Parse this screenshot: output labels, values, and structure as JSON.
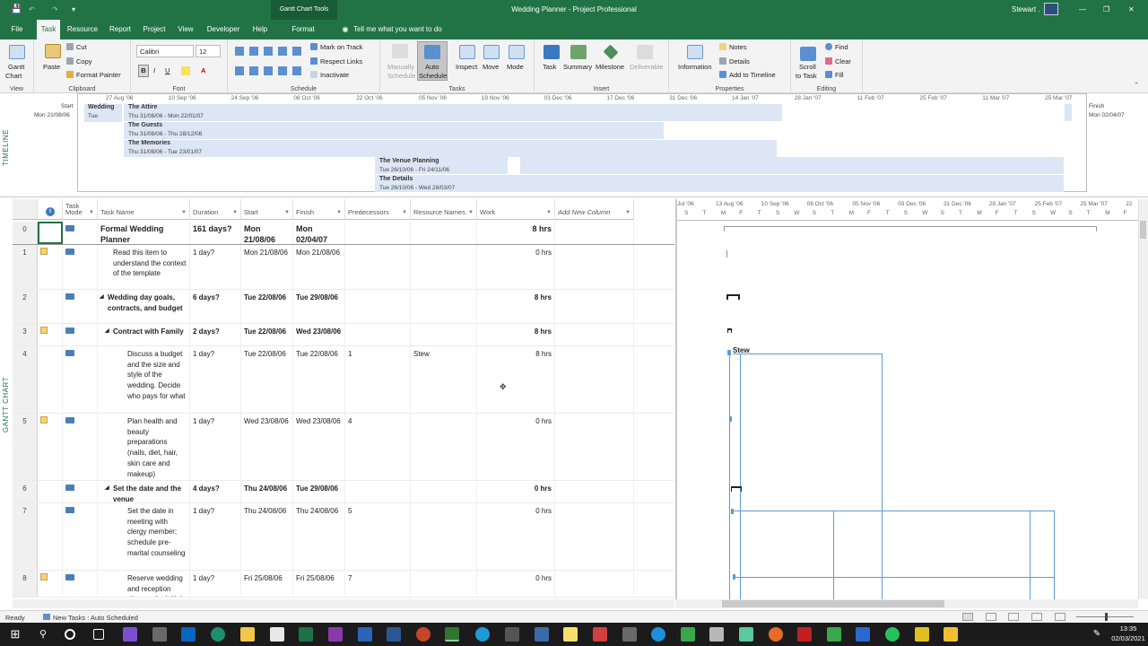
{
  "titlebar": {
    "context_tab": "Gantt Chart Tools",
    "title": "Wedding Planner  -  Project Professional",
    "user": "Stewart .",
    "tell_me": "Tell me what you want to do"
  },
  "tabs": [
    {
      "label": "File"
    },
    {
      "label": "Task"
    },
    {
      "label": "Resource"
    },
    {
      "label": "Report"
    },
    {
      "label": "Project"
    },
    {
      "label": "View"
    },
    {
      "label": "Developer"
    },
    {
      "label": "Help"
    },
    {
      "label": "Format"
    }
  ],
  "ribbon": {
    "view": {
      "gantt_chart": "Gantt",
      "gantt_chart2": "Chart",
      "label": "View"
    },
    "clipboard": {
      "paste": "Paste",
      "cut": "Cut",
      "copy": "Copy",
      "format_painter": "Format Painter",
      "label": "Clipboard"
    },
    "font": {
      "name": "Calibri",
      "size": "12",
      "bold": "B",
      "italic": "I",
      "underline": "U",
      "label": "Font"
    },
    "schedule": {
      "mark_on_track": "Mark on Track",
      "respect_links": "Respect Links",
      "inactivate": "Inactivate",
      "label": "Schedule"
    },
    "tasks": {
      "manually": "Manually",
      "schedule1": "Schedule",
      "auto": "Auto",
      "schedule2": "Schedule",
      "inspect": "Inspect",
      "move": "Move",
      "mode": "Mode",
      "label": "Tasks"
    },
    "insert": {
      "task": "Task",
      "summary": "Summary",
      "milestone": "Milestone",
      "deliverable": "Deliverable",
      "label": "Insert"
    },
    "properties": {
      "information": "Information",
      "notes": "Notes",
      "details": "Details",
      "add_to_timeline": "Add to Timeline",
      "label": "Properties"
    },
    "editing": {
      "scroll1": "Scroll",
      "scroll2": "to Task",
      "find": "Find",
      "clear": "Clear",
      "fill": "Fill",
      "label": "Editing"
    }
  },
  "timeline": {
    "label": "TIMELINE",
    "start_label": "Start",
    "start_date": "Mon 21/08/06",
    "finish_label": "Finish",
    "finish_date": "Mon 02/04/07",
    "scale": [
      "27 Aug '06",
      "10 Sep '06",
      "24 Sep '06",
      "08 Oct '06",
      "22 Oct '06",
      "05 Nov '06",
      "19 Nov '06",
      "03 Dec '06",
      "17 Dec '06",
      "31 Dec '06",
      "14 Jan '07",
      "28 Jan '07",
      "11 Feb '07",
      "25 Feb '07",
      "11 Mar '07",
      "25 Mar '07"
    ],
    "wedding": {
      "title": "Wedding",
      "date": "Tue"
    },
    "bars": [
      {
        "title": "The Attire",
        "dates": "Thu 31/08/06 - Mon 22/01/07"
      },
      {
        "title": "The Guests",
        "dates": "Thu 31/08/06 - Thu 28/12/06"
      },
      {
        "title": "The Memories",
        "dates": "Thu 31/08/06 - Tue 23/01/07"
      },
      {
        "title": "The Venue Planning",
        "dates": "Tue 26/10/06 - Fri 24/11/06"
      },
      {
        "title": "The Details",
        "dates": "Tue 26/10/06 - Wed 28/03/07"
      }
    ]
  },
  "grid": {
    "headers": {
      "info": "i",
      "task_mode1": "Task",
      "task_mode2": "Mode",
      "task_name": "Task Name",
      "duration": "Duration",
      "start": "Start",
      "finish": "Finish",
      "predecessors": "Predecessors",
      "resource_names": "Resource Names",
      "work": "Work",
      "add_new": "Add New Column"
    },
    "rows": [
      {
        "id": "0",
        "name": "Formal Wedding Planner",
        "duration": "161 days?",
        "start": "Mon 21/08/06",
        "finish": "Mon 02/04/07",
        "pred": "",
        "res": "",
        "work": "8 hrs"
      },
      {
        "id": "1",
        "name": "Read this item to understand the context of the template",
        "duration": "1 day?",
        "start": "Mon 21/08/06",
        "finish": "Mon 21/08/06",
        "pred": "",
        "res": "",
        "work": "0 hrs"
      },
      {
        "id": "2",
        "name": "Wedding day goals, contracts, and budget",
        "duration": "6 days?",
        "start": "Tue 22/08/06",
        "finish": "Tue 29/08/06",
        "pred": "",
        "res": "",
        "work": "8 hrs"
      },
      {
        "id": "3",
        "name": "Contract with Family",
        "duration": "2 days?",
        "start": "Tue 22/08/06",
        "finish": "Wed 23/08/06",
        "pred": "",
        "res": "",
        "work": "8 hrs"
      },
      {
        "id": "4",
        "name": "Discuss a budget and the size and style of the wedding. Decide who pays for what",
        "duration": "1 day?",
        "start": "Tue 22/08/06",
        "finish": "Tue 22/08/06",
        "pred": "1",
        "res": "Stew",
        "work": "8 hrs"
      },
      {
        "id": "5",
        "name": "Plan health and beauty preparations (nails, diet, hair, skin care and makeup)",
        "duration": "1 day?",
        "start": "Wed 23/08/06",
        "finish": "Wed 23/08/06",
        "pred": "4",
        "res": "",
        "work": "0 hrs"
      },
      {
        "id": "6",
        "name": "Set the date and the venue",
        "duration": "4 days?",
        "start": "Thu 24/08/06",
        "finish": "Tue 29/08/06",
        "pred": "",
        "res": "",
        "work": "0 hrs"
      },
      {
        "id": "7",
        "name": "Set the date in meeting with clergy member; schedule pre-marital counseling",
        "duration": "1 day?",
        "start": "Thu 24/08/06",
        "finish": "Thu 24/08/06",
        "pred": "5",
        "res": "",
        "work": "0 hrs"
      },
      {
        "id": "8",
        "name": "Reserve wedding and reception sites; make initial",
        "duration": "1 day?",
        "start": "Fri 25/08/06",
        "finish": "Fri 25/08/06",
        "pred": "7",
        "res": "",
        "work": "0 hrs"
      }
    ]
  },
  "gantt": {
    "label": "GANTT CHART",
    "top_scale": [
      "Jul '06",
      "13 Aug '06",
      "10 Sep '06",
      "08 Oct '06",
      "05 Nov '06",
      "03 Dec '06",
      "31 Dec '06",
      "28 Jan '07",
      "25 Feb '07",
      "25 Mar '07",
      "22"
    ],
    "day_letters": [
      "S",
      "T",
      "M",
      "F",
      "T",
      "S",
      "W",
      "S",
      "T",
      "M",
      "F",
      "T",
      "S",
      "W",
      "S",
      "T",
      "M",
      "F",
      "T",
      "S",
      "W",
      "S",
      "T",
      "M",
      "F",
      "T",
      "S",
      "W",
      "S",
      "T",
      "M",
      "F"
    ],
    "resource_label": "Stew"
  },
  "status": {
    "ready": "Ready",
    "new_tasks": "New Tasks : Auto Scheduled"
  },
  "taskbar": {
    "time": "13:35",
    "date": "02/03/2021"
  },
  "colors": {
    "brand": "#217346",
    "bar": "#5b9bd5",
    "timeline_bar": "#dce6f4"
  }
}
